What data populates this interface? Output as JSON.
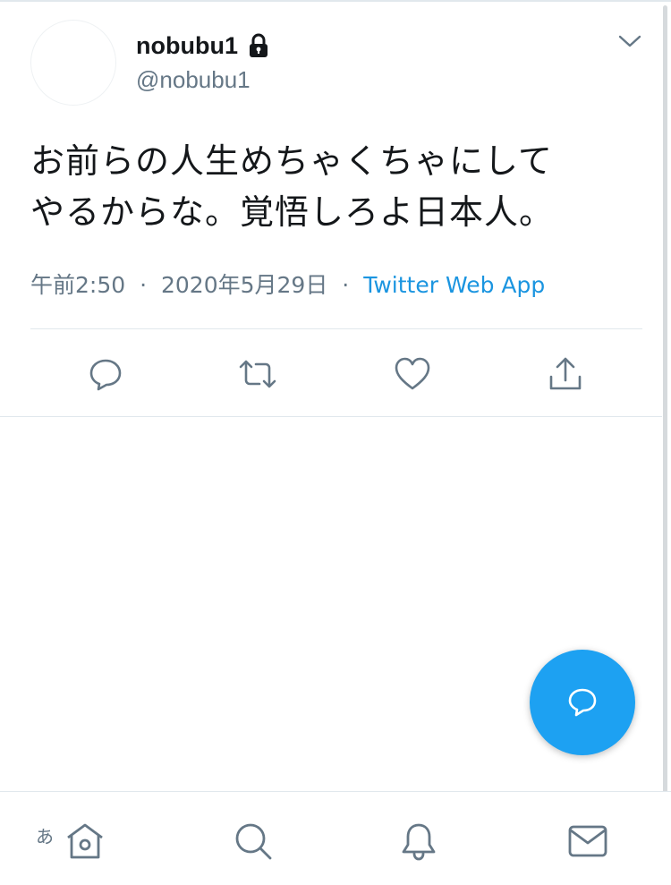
{
  "tweet": {
    "display_name": "nobubu1",
    "handle": "@nobubu1",
    "text_line1": "お前らの人生めちゃくちゃにして",
    "text_line2": "やるからな。覚悟しろよ日本人。",
    "time": "午前2:50",
    "date": "2020年5月29日",
    "separator": "·",
    "source": "Twitter Web App"
  },
  "icons": {
    "lock": "lock-icon",
    "caret": "chevron-down-icon",
    "reply": "reply-icon",
    "retweet": "retweet-icon",
    "like": "heart-icon",
    "share": "share-icon",
    "compose": "compose-icon",
    "home": "home-icon",
    "search": "search-icon",
    "notifications": "bell-icon",
    "messages": "envelope-icon"
  },
  "tabbar": {
    "ime_badge": "あ"
  },
  "colors": {
    "accent": "#1da1f2",
    "link": "#1b95e0",
    "secondary_text": "#657786",
    "icon": "#657786",
    "divider": "#e1e8ed"
  }
}
